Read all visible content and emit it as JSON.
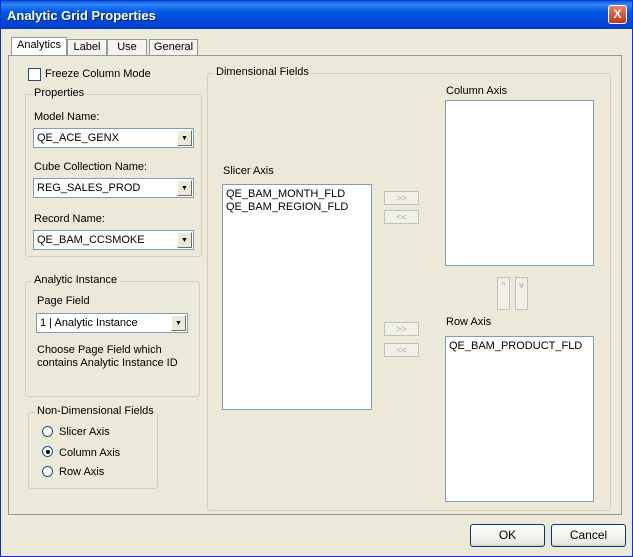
{
  "window": {
    "title": "Analytic Grid Properties",
    "close_glyph": "X"
  },
  "tabs": [
    {
      "label": "Analytics",
      "active": true
    },
    {
      "label": "Label",
      "active": false
    },
    {
      "label": "Use",
      "active": false
    },
    {
      "label": "General",
      "active": false
    }
  ],
  "freeze_column_mode": {
    "label": "Freeze Column Mode",
    "checked": false
  },
  "properties": {
    "legend": "Properties",
    "model_name": {
      "label": "Model Name:",
      "value": "QE_ACE_GENX"
    },
    "cube_collection": {
      "label": "Cube Collection Name:",
      "value": "REG_SALES_PROD"
    },
    "record_name": {
      "label": "Record Name:",
      "value": "QE_BAM_CCSMOKE"
    }
  },
  "analytic_instance": {
    "legend": "Analytic Instance",
    "page_field_label": "Page Field",
    "page_field_value": "1 | Analytic Instance",
    "hint_line1": "Choose Page Field which",
    "hint_line2": "contains Analytic Instance ID"
  },
  "non_dimensional": {
    "legend": "Non-Dimensional Fields",
    "options": [
      {
        "label": "Slicer Axis",
        "selected": false
      },
      {
        "label": "Column Axis",
        "selected": true
      },
      {
        "label": "Row Axis",
        "selected": false
      }
    ]
  },
  "dimensional": {
    "legend": "Dimensional Fields",
    "slicer_label": "Slicer Axis",
    "slicer_items": [
      "QE_BAM_MONTH_FLD",
      "QE_BAM_REGION_FLD"
    ],
    "column_label": "Column Axis",
    "column_items": [],
    "row_label": "Row Axis",
    "row_items": [
      "QE_BAM_PRODUCT_FLD"
    ],
    "move_right": ">>",
    "move_left": "<<",
    "move_up": "^",
    "move_down": "v"
  },
  "buttons": {
    "ok": "OK",
    "cancel": "Cancel"
  },
  "colors": {
    "titlebar": "#0055e5",
    "face": "#ece9d8",
    "list_border": "#7f9db9"
  }
}
